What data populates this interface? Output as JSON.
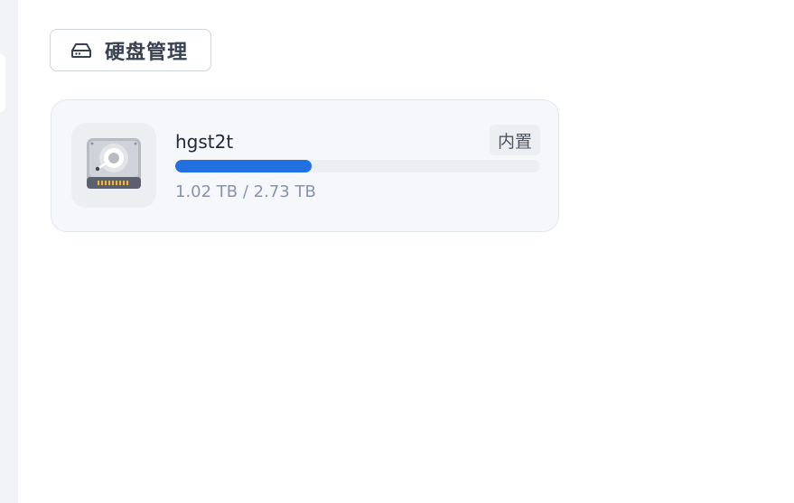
{
  "section": {
    "title": "硬盘管理",
    "icon": "hard-drive-icon"
  },
  "disks": [
    {
      "name": "hgst2t",
      "badge": "内置",
      "icon": "hard-disk-icon",
      "usage_text": "1.02 TB / 2.73 TB",
      "usage_fraction": 0.374
    }
  ],
  "colors": {
    "accent": "#2370e0",
    "track": "#eceef2",
    "card_bg": "#f6f7fa",
    "sidebar_bg": "#f1f3f7",
    "title_text": "#374151",
    "muted_text": "#8594ad"
  }
}
